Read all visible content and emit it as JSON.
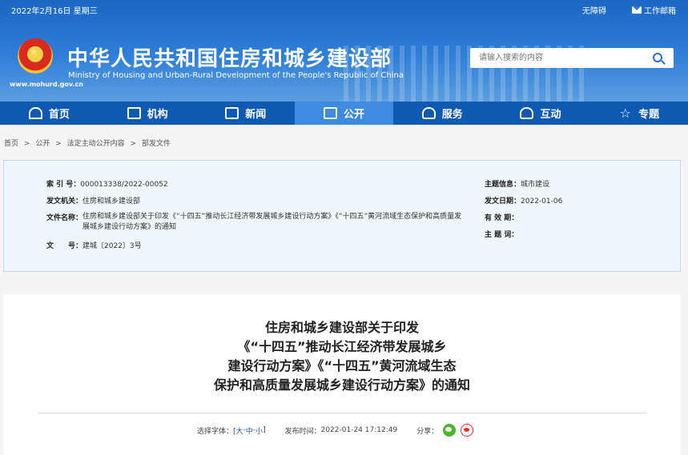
{
  "topbar": {
    "date": "2022年2月16日 星期三",
    "accessibility": "无障碍",
    "webmail": "工作邮箱"
  },
  "header": {
    "domain": "www.mohurd.gov.cn",
    "title": "中华人民共和国住房和城乡建设部",
    "subtitle": "Ministry of Housing and Urban-Rural Development of the People's Republic of China"
  },
  "search": {
    "placeholder": "请输入搜索的内容"
  },
  "nav": [
    {
      "label": "首页",
      "icon": "home-icon"
    },
    {
      "label": "机构",
      "icon": "building-icon"
    },
    {
      "label": "新闻",
      "icon": "news-icon"
    },
    {
      "label": "公开",
      "icon": "disclosure-icon"
    },
    {
      "label": "服务",
      "icon": "service-icon"
    },
    {
      "label": "互动",
      "icon": "users-icon"
    },
    {
      "label": "专题",
      "icon": "star-icon"
    }
  ],
  "breadcrumb": [
    "首页",
    ">",
    "公开",
    ">",
    "法定主动公开内容",
    ">",
    "部发文件"
  ],
  "info": {
    "index_label": "索 引 号：",
    "index_value": "000013338/2022-00052",
    "issuer_label": "发文机关：",
    "issuer_value": "住房和城乡建设部",
    "docname_label": "文件名称：",
    "docname_value": "住房和城乡建设部关于印发《“十四五”推动长江经济带发展城乡建设行动方案》《“十四五”黄河流域生态保护和高质量发展城乡建设行动方案》的通知",
    "docno_label": "文　　号：",
    "docno_value": "建城〔2022〕3号",
    "topic_label": "主题信息：",
    "topic_value": "城市建设",
    "date_label": "发文日期：",
    "date_value": "2022-01-06",
    "validity_label": "有 效 期：",
    "validity_value": "",
    "keywords_label": "主 题 词：",
    "keywords_value": ""
  },
  "article": {
    "title_lines": [
      "住房和城乡建设部关于印发",
      "《“十四五”推动长江经济带发展城乡",
      "建设行动方案》《“十四五”黄河流域生态",
      "保护和高质量发展城乡建设行动方案》的通知"
    ],
    "font_label": "选择字体：[",
    "font_large": "大",
    "font_sep1": "-",
    "font_medium": "中",
    "font_sep2": "-",
    "font_small": "小",
    "font_end": "]",
    "publish_label": "发布时间：",
    "publish_time": "2022-01-24 17:12:49",
    "share_label": "分享："
  }
}
